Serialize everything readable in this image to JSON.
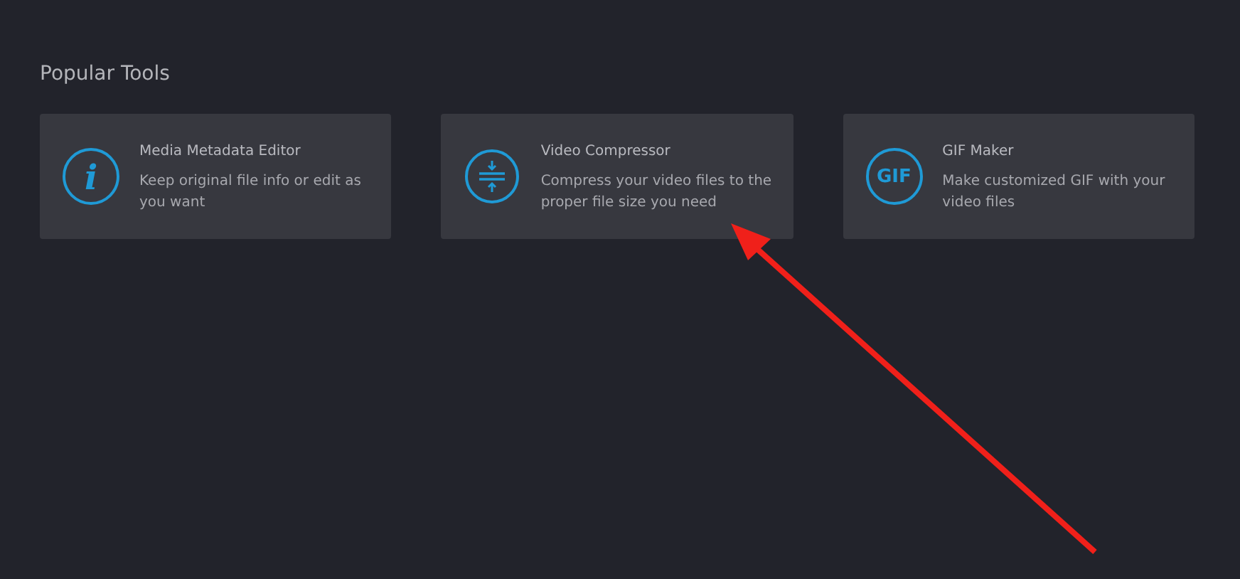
{
  "section": {
    "title": "Popular Tools"
  },
  "tools": [
    {
      "kind": "info",
      "icon_text": "i",
      "title": "Media Metadata Editor",
      "description": "Keep original file info or edit as you want"
    },
    {
      "kind": "compress",
      "title": "Video Compressor",
      "description": "Compress your video files to the proper file size you need"
    },
    {
      "kind": "gif",
      "icon_text": "GIF",
      "title": "GIF Maker",
      "description": "Make customized GIF with your video files"
    }
  ],
  "annotation": {
    "kind": "arrow",
    "color": "#f0201a"
  }
}
